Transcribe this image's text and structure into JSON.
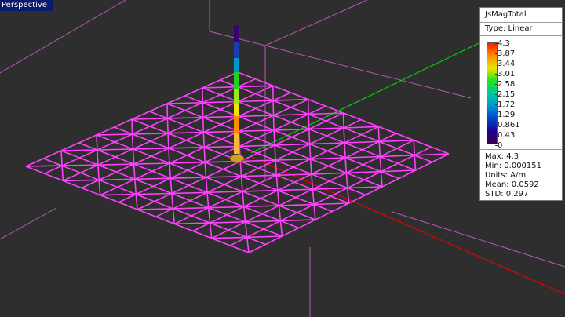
{
  "viewport": {
    "label": "Perspective"
  },
  "legend": {
    "title": "JsMagTotal",
    "type": "Type: Linear",
    "ticks": [
      "4.3",
      "3.87",
      "3.44",
      "3.01",
      "2.58",
      "2.15",
      "1.72",
      "1.29",
      "0.861",
      "0.43",
      "0"
    ],
    "stats": {
      "max": "Max: 4.3",
      "min": "Min: 0.000151",
      "units": "Units: A/m",
      "mean": "Mean: 0.0592",
      "std": "STD: 0.297"
    }
  },
  "colors": {
    "background": "#2e2e2e",
    "mesh": "#ff40ff",
    "box": "#b45ab4",
    "axis_x": "#e60000",
    "axis_y": "#00d200"
  }
}
